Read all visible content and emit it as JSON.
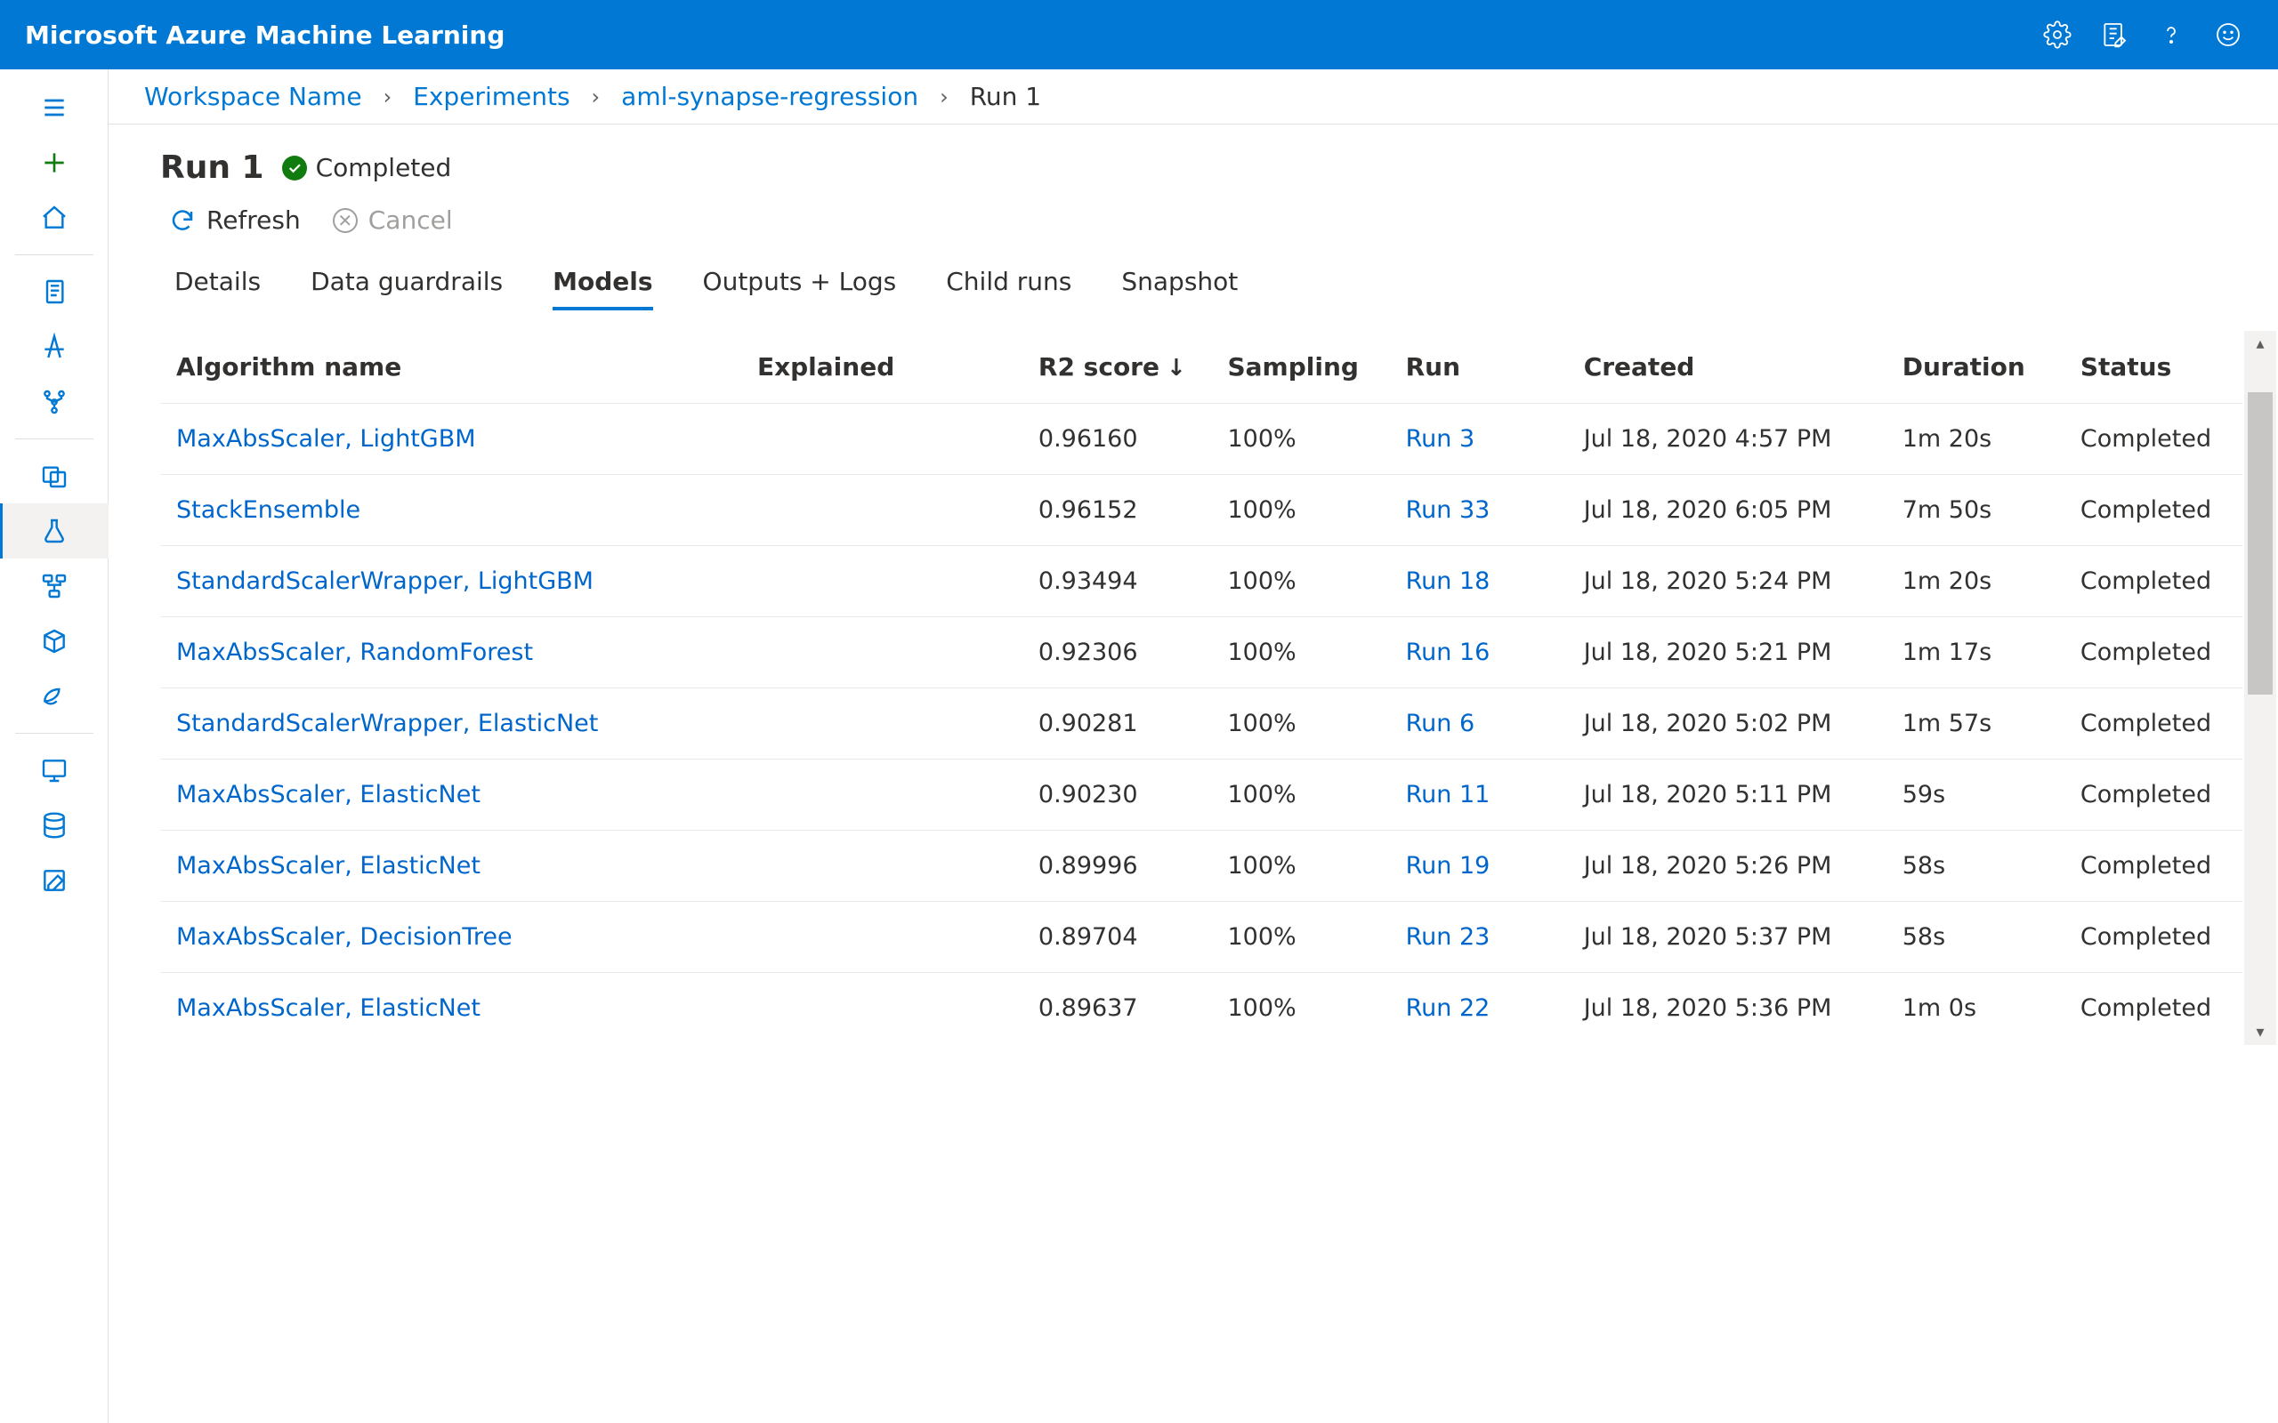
{
  "header": {
    "product_name": "Microsoft Azure Machine Learning"
  },
  "breadcrumb": {
    "workspace": "Workspace Name",
    "experiments": "Experiments",
    "experiment_name": "aml-synapse-regression",
    "current": "Run 1"
  },
  "page": {
    "title": "Run 1",
    "status_label": "Completed"
  },
  "commands": {
    "refresh": "Refresh",
    "cancel": "Cancel"
  },
  "tabs": {
    "details": "Details",
    "guardrails": "Data guardrails",
    "models": "Models",
    "outputs": "Outputs + Logs",
    "child_runs": "Child runs",
    "snapshot": "Snapshot"
  },
  "columns": {
    "algorithm": "Algorithm name",
    "explained": "Explained",
    "r2": "R2 score",
    "sampling": "Sampling",
    "run": "Run",
    "created": "Created",
    "duration": "Duration",
    "status": "Status"
  },
  "rows": [
    {
      "algorithm": "MaxAbsScaler, LightGBM",
      "explained": "",
      "r2": "0.96160",
      "sampling": "100%",
      "run": "Run 3",
      "created": "Jul 18, 2020 4:57 PM",
      "duration": "1m 20s",
      "status": "Completed"
    },
    {
      "algorithm": "StackEnsemble",
      "explained": "",
      "r2": "0.96152",
      "sampling": "100%",
      "run": "Run 33",
      "created": "Jul 18, 2020 6:05 PM",
      "duration": "7m 50s",
      "status": "Completed"
    },
    {
      "algorithm": "StandardScalerWrapper, LightGBM",
      "explained": "",
      "r2": "0.93494",
      "sampling": "100%",
      "run": "Run 18",
      "created": "Jul 18, 2020 5:24 PM",
      "duration": "1m 20s",
      "status": "Completed"
    },
    {
      "algorithm": "MaxAbsScaler, RandomForest",
      "explained": "",
      "r2": "0.92306",
      "sampling": "100%",
      "run": "Run 16",
      "created": "Jul 18, 2020 5:21 PM",
      "duration": "1m 17s",
      "status": "Completed"
    },
    {
      "algorithm": "StandardScalerWrapper, ElasticNet",
      "explained": "",
      "r2": "0.90281",
      "sampling": "100%",
      "run": "Run 6",
      "created": "Jul 18, 2020 5:02 PM",
      "duration": "1m 57s",
      "status": "Completed"
    },
    {
      "algorithm": "MaxAbsScaler, ElasticNet",
      "explained": "",
      "r2": "0.90230",
      "sampling": "100%",
      "run": "Run 11",
      "created": "Jul 18, 2020 5:11 PM",
      "duration": "59s",
      "status": "Completed"
    },
    {
      "algorithm": "MaxAbsScaler, ElasticNet",
      "explained": "",
      "r2": "0.89996",
      "sampling": "100%",
      "run": "Run 19",
      "created": "Jul 18, 2020 5:26 PM",
      "duration": "58s",
      "status": "Completed"
    },
    {
      "algorithm": "MaxAbsScaler, DecisionTree",
      "explained": "",
      "r2": "0.89704",
      "sampling": "100%",
      "run": "Run 23",
      "created": "Jul 18, 2020 5:37 PM",
      "duration": "58s",
      "status": "Completed"
    },
    {
      "algorithm": "MaxAbsScaler, ElasticNet",
      "explained": "",
      "r2": "0.89637",
      "sampling": "100%",
      "run": "Run 22",
      "created": "Jul 18, 2020 5:36 PM",
      "duration": "1m 0s",
      "status": "Completed"
    }
  ]
}
